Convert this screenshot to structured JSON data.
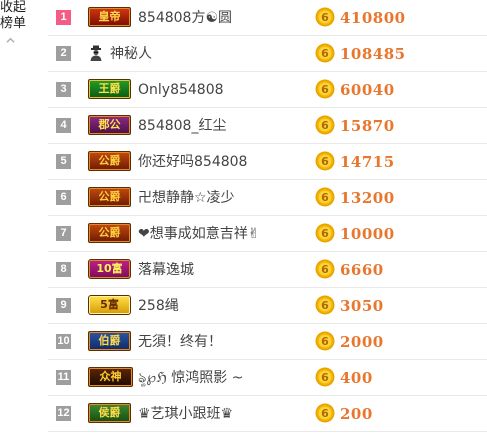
{
  "collapse": {
    "line1": "收起",
    "line2": "榜单"
  },
  "coin": {
    "glyph": "6",
    "color": "#f5b800"
  },
  "colors": {
    "score": "#e8762d",
    "rank_first": "#f25c86",
    "rank_other": "#9e9e9e"
  },
  "rows": [
    {
      "rank": "1",
      "badge": "皇帝",
      "badge_style": "emperor",
      "name": "854808方☯圆",
      "score": "410800"
    },
    {
      "rank": "2",
      "badge": "",
      "badge_style": "mystery",
      "name": "神秘人",
      "score": "108485"
    },
    {
      "rank": "3",
      "badge": "王爵",
      "badge_style": "king",
      "name": "Only854808",
      "score": "60040"
    },
    {
      "rank": "4",
      "badge": "郡公",
      "badge_style": "shire",
      "name": "854808_红尘",
      "score": "15870"
    },
    {
      "rank": "5",
      "badge": "公爵",
      "badge_style": "duke",
      "name": "你还好吗854808",
      "score": "14715"
    },
    {
      "rank": "6",
      "badge": "公爵",
      "badge_style": "duke",
      "name": "卍想静静☆凌少",
      "score": "13200"
    },
    {
      "rank": "7",
      "badge": "公爵",
      "badge_style": "duke",
      "name": "❤想事成如意吉祥✌",
      "score": "10000"
    },
    {
      "rank": "8",
      "badge": "10富",
      "badge_style": "rich10",
      "name": "落幕逸城",
      "score": "6660"
    },
    {
      "rank": "9",
      "badge": "5富",
      "badge_style": "rich5",
      "name": "258绳",
      "score": "3050"
    },
    {
      "rank": "10",
      "badge": "伯爵",
      "badge_style": "earl",
      "name": "无須！终有！",
      "score": "2000"
    },
    {
      "rank": "11",
      "badge": "众神",
      "badge_style": "god",
      "name": "ৡ℘ℌ 惊鸿照影 ~",
      "score": "400"
    },
    {
      "rank": "12",
      "badge": "侯爵",
      "badge_style": "marquis",
      "name": "♛艺琪小跟班♛",
      "score": "200"
    }
  ]
}
